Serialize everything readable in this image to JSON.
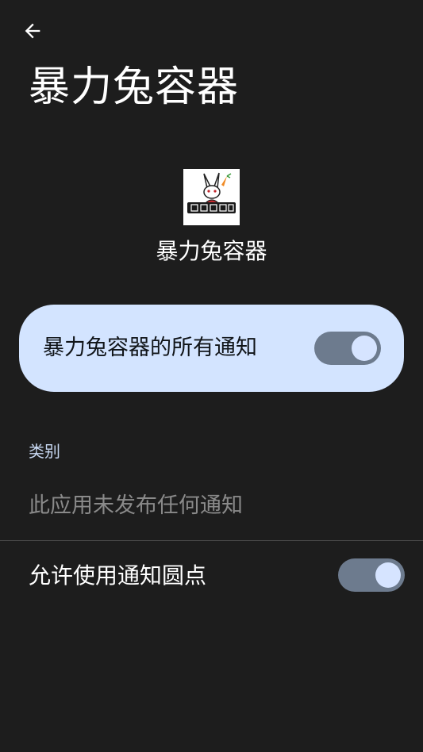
{
  "header": {
    "back_icon": "arrow-back-icon",
    "title": "暴力兔容器"
  },
  "app": {
    "icon_name": "app-logo-rabbit",
    "icon_text": "暴力兔自养",
    "name": "暴力兔容器"
  },
  "master_toggle": {
    "label": "暴力兔容器的所有通知",
    "enabled": true
  },
  "categories": {
    "header": "类别",
    "empty_text": "此应用未发布任何通知"
  },
  "notification_dots": {
    "label": "允许使用通知圆点",
    "enabled": true
  },
  "colors": {
    "background": "#1d1d1d",
    "card": "#d3e4ff",
    "switch_track": "#6d7b8e",
    "switch_thumb": "#d6e4ff",
    "section_header": "#c8d8f2"
  }
}
